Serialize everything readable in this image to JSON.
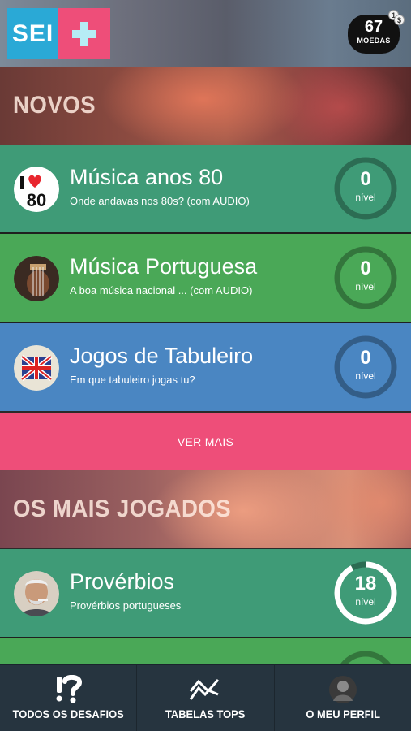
{
  "header": {
    "logo_text": "SEI",
    "coins_value": "67",
    "coins_label": "MOEDAS",
    "coin_badge_1": "1",
    "coin_badge_2": "$"
  },
  "sections": {
    "novos_title": "NOVOS",
    "mais_jogados_title": "OS MAIS JOGADOS"
  },
  "quizzes": [
    {
      "name": "Música anos 80",
      "subtitle": "Onde andavas nos 80s? (com AUDIO)",
      "level": "0",
      "level_label": "nível",
      "progress": 0,
      "color": "#3f9b77",
      "avatar_icon": "i-love-80s-icon",
      "avatar_text": "80"
    },
    {
      "name": "Música Portuguesa",
      "subtitle": "A boa música nacional ... (com AUDIO)",
      "level": "0",
      "level_label": "nível",
      "progress": 0,
      "color": "#4aa857",
      "avatar_icon": "portuguese-guitar-icon"
    },
    {
      "name": "Jogos de Tabuleiro",
      "subtitle": "Em que tabuleiro jogas tu?",
      "level": "0",
      "level_label": "nível",
      "progress": 0,
      "color": "#4a86c2",
      "avatar_icon": "board-game-icon"
    },
    {
      "name": "Provérbios",
      "subtitle": "Provérbios portugueses",
      "level": "18",
      "level_label": "nível",
      "progress": 0.92,
      "color": "#3f9b77",
      "avatar_icon": "old-man-photo-icon"
    }
  ],
  "ver_mais_label": "VER MAIS",
  "bottom_nav": [
    {
      "label": "TODOS OS DESAFIOS",
      "icon": "question-exclamation-icon"
    },
    {
      "label": "TABELAS TOPS",
      "icon": "trend-chart-icon"
    },
    {
      "label": "O MEU PERFIL",
      "icon": "profile-avatar-icon"
    }
  ],
  "colors": {
    "accent_pink": "#ee4e79",
    "accent_blue": "#2aa9d6",
    "nav_bg": "#26343f"
  }
}
